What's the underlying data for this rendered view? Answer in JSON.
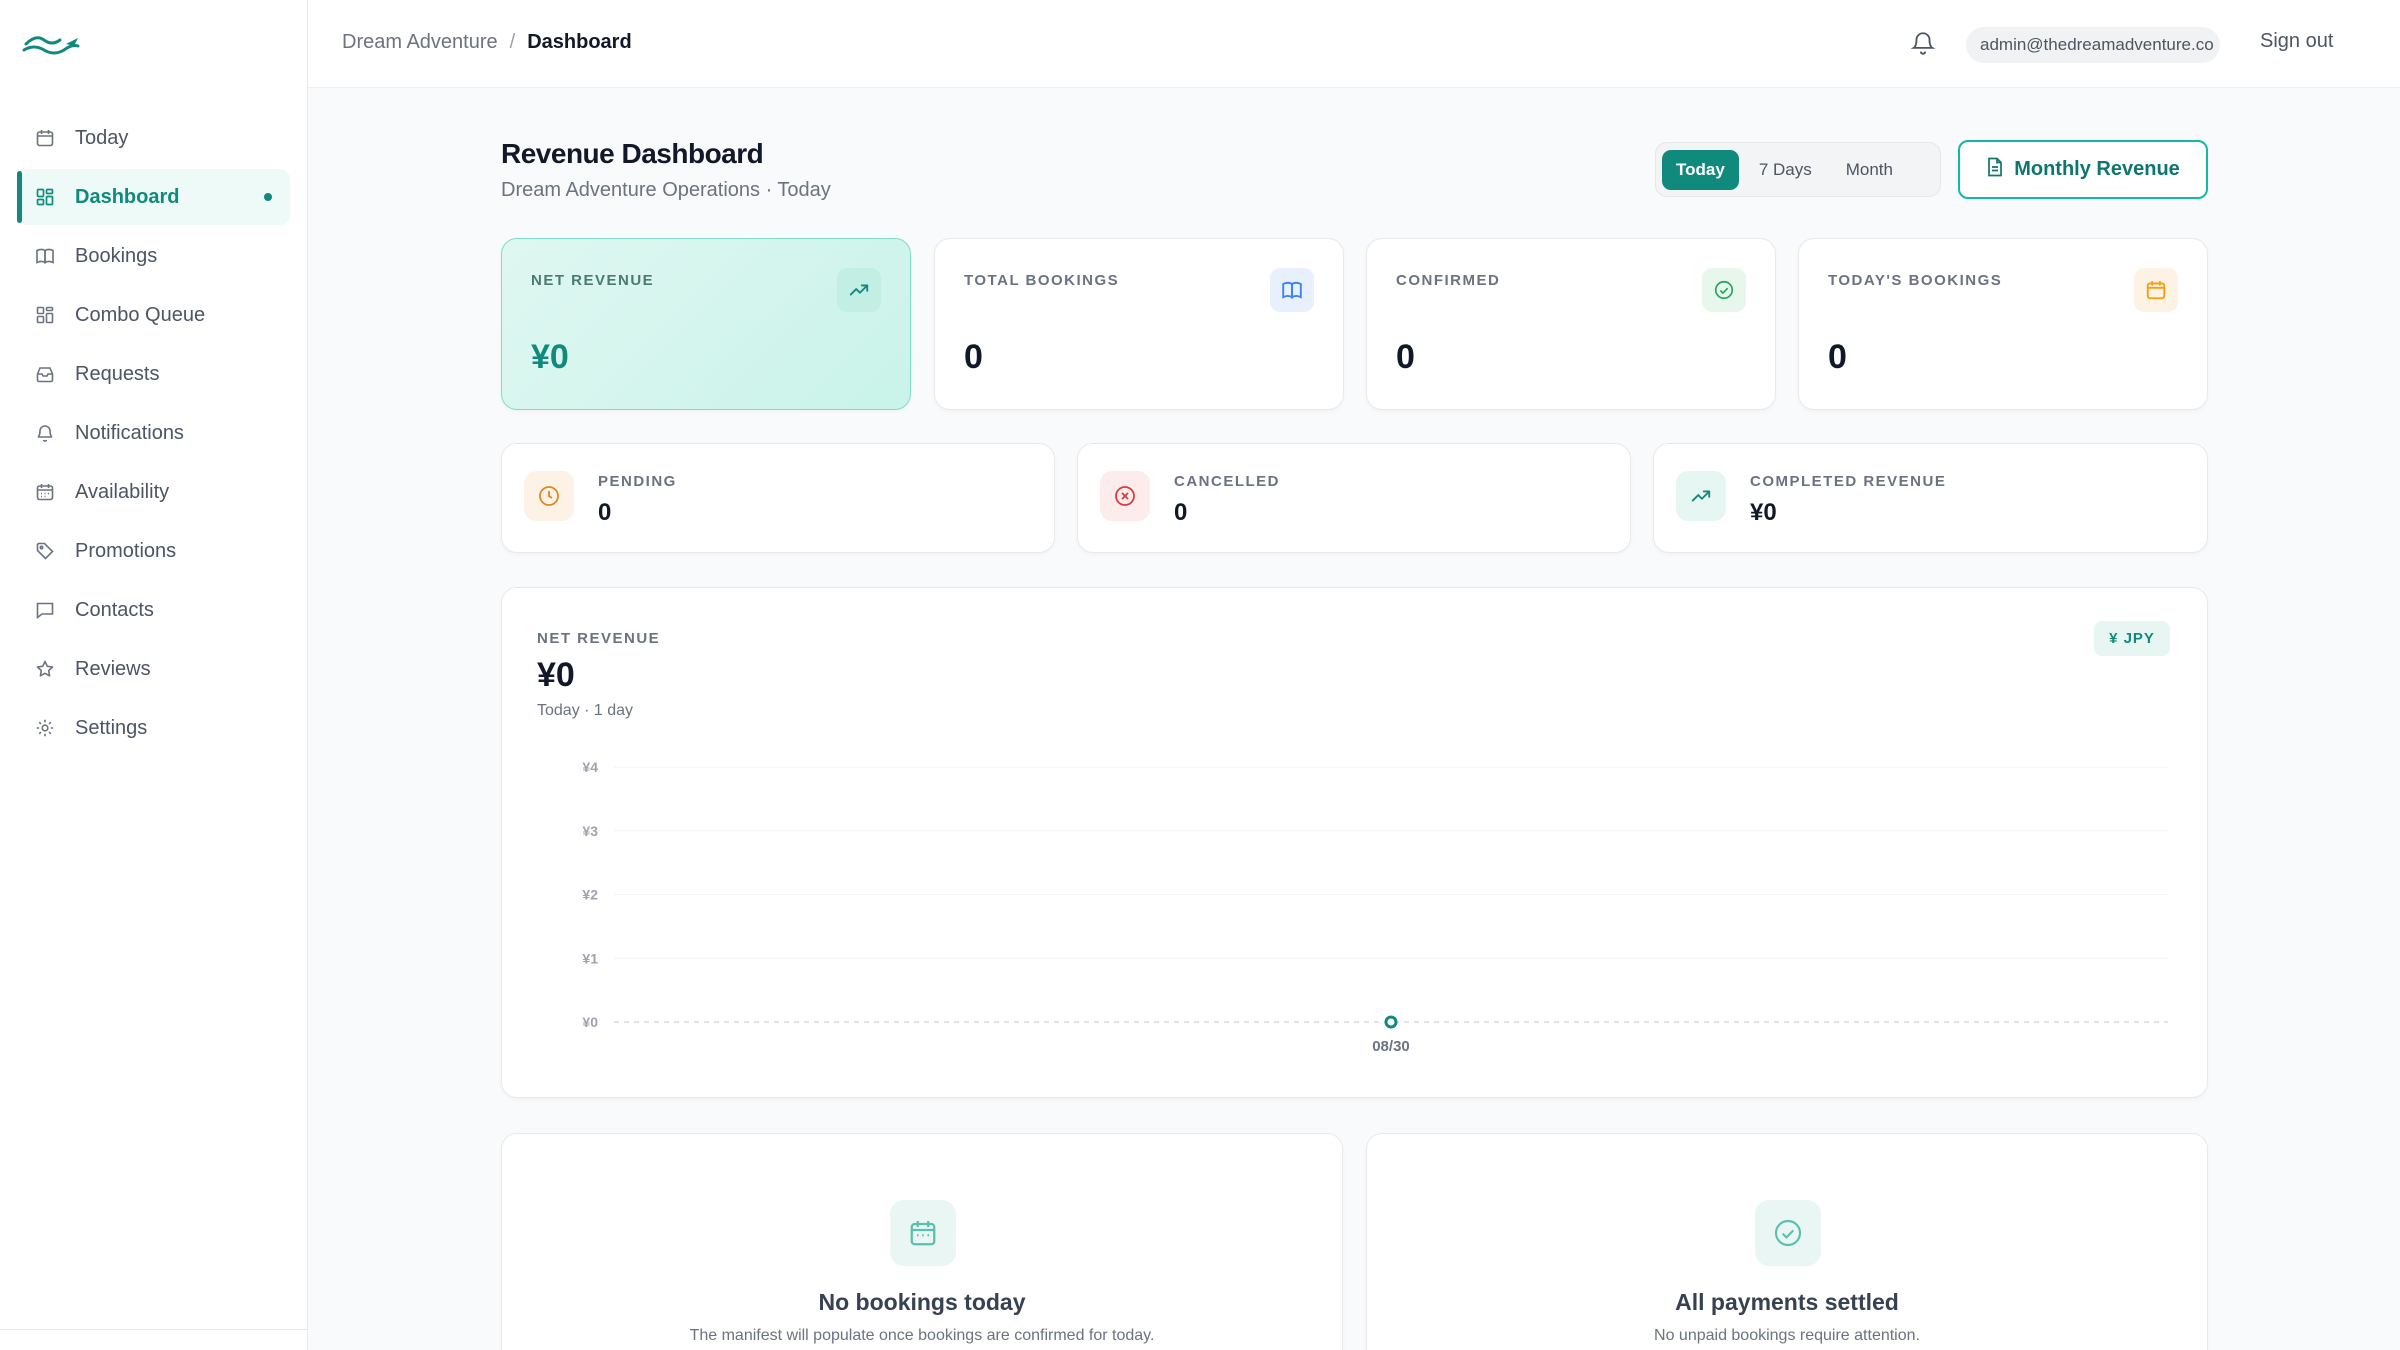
{
  "sidebar": {
    "items": [
      {
        "label": "Today",
        "icon": "calendar-icon"
      },
      {
        "label": "Dashboard",
        "icon": "grid-icon",
        "active": true
      },
      {
        "label": "Bookings",
        "icon": "book-icon"
      },
      {
        "label": "Combo Queue",
        "icon": "layers-icon"
      },
      {
        "label": "Requests",
        "icon": "inbox-icon"
      },
      {
        "label": "Notifications",
        "icon": "bell-icon"
      },
      {
        "label": "Availability",
        "icon": "calendar-icon"
      },
      {
        "label": "Promotions",
        "icon": "tag-icon"
      },
      {
        "label": "Contacts",
        "icon": "message-icon"
      },
      {
        "label": "Reviews",
        "icon": "star-icon"
      },
      {
        "label": "Settings",
        "icon": "gear-icon"
      }
    ]
  },
  "topbar": {
    "breadcrumb_root": "Dream Adventure",
    "breadcrumb_sep": "/",
    "breadcrumb_current": "Dashboard",
    "user_email": "admin@thedreamadventure.co",
    "sign_out": "Sign out"
  },
  "header": {
    "title": "Revenue Dashboard",
    "subtitle": "Dream Adventure Operations · Today",
    "ranges": [
      "Today",
      "7 Days",
      "Month"
    ],
    "active_range": "Today",
    "monthly_button": "Monthly Revenue"
  },
  "stats": {
    "net_revenue": {
      "label": "NET REVENUE",
      "value": "¥0"
    },
    "total_bookings": {
      "label": "TOTAL BOOKINGS",
      "value": "0"
    },
    "confirmed": {
      "label": "CONFIRMED",
      "value": "0"
    },
    "todays_bookings": {
      "label": "TODAY'S BOOKINGS",
      "value": "0"
    }
  },
  "secondary_stats": {
    "pending": {
      "label": "PENDING",
      "value": "0"
    },
    "cancelled": {
      "label": "CANCELLED",
      "value": "0"
    },
    "completed_revenue": {
      "label": "COMPLETED REVENUE",
      "value": "¥0"
    }
  },
  "revenue_chart": {
    "label": "NET REVENUE",
    "value": "¥0",
    "subtitle": "Today · 1 day",
    "currency_badge": "¥ JPY"
  },
  "chart_data": {
    "type": "line",
    "title": "",
    "x": [
      "08/30"
    ],
    "series": [
      {
        "values": [
          0
        ]
      }
    ],
    "y_ticks": [
      "¥0",
      "¥1",
      "¥2",
      "¥3",
      "¥4"
    ],
    "ylim": [
      0,
      4
    ],
    "grid": true
  },
  "panels": {
    "bookings": {
      "title": "No bookings today",
      "text": "The manifest will populate once bookings are confirmed for today."
    },
    "payments": {
      "title": "All payments settled",
      "text": "No unpaid bookings require attention."
    }
  },
  "colors": {
    "accent": "#0f8a7d",
    "accent_light": "#14b8a6"
  }
}
